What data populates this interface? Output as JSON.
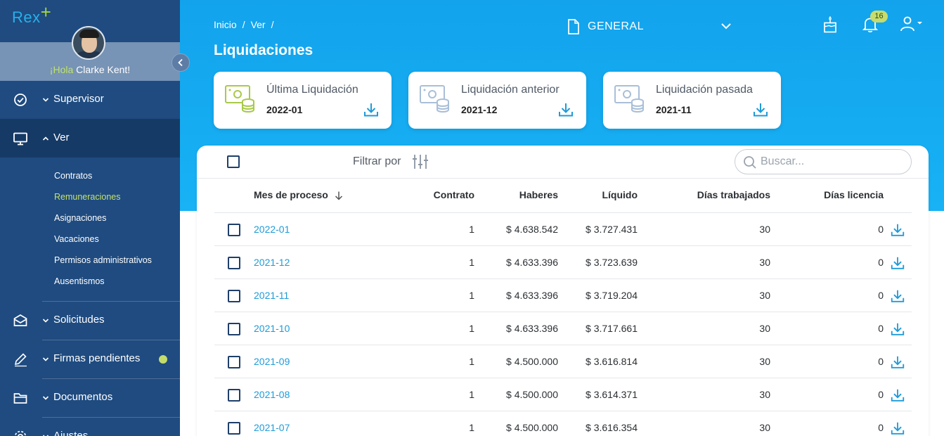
{
  "app": {
    "logo_text": "Rex",
    "logo_plus": "+"
  },
  "user": {
    "greeting": "¡Hola",
    "name": "Clarke Kent!"
  },
  "colors": {
    "sidebar": "#1f4b80",
    "header": "#12a3ec",
    "accent_green": "#c4dc6a",
    "link": "#1e9bd8"
  },
  "sidebar": {
    "collapse_icon": "chevron-left-icon",
    "items": [
      {
        "label": "Supervisor",
        "icon": "check-circle-icon",
        "expanded": false
      },
      {
        "label": "Ver",
        "icon": "monitor-icon",
        "expanded": true
      },
      {
        "label": "Solicitudes",
        "icon": "envelope-icon",
        "expanded": false
      },
      {
        "label": "Firmas pendientes",
        "icon": "pen-icon",
        "expanded": false
      },
      {
        "label": "Documentos",
        "icon": "folder-icon",
        "expanded": false
      },
      {
        "label": "Ajustes",
        "icon": "gear-icon",
        "expanded": false
      }
    ],
    "subitems": [
      "Contratos",
      "Remuneraciones",
      "Asignaciones",
      "Vacaciones",
      "Permisos administrativos",
      "Ausentismos"
    ],
    "current_subitem": "Remuneraciones"
  },
  "header": {
    "breadcrumb": [
      "Inicio",
      "/",
      "Ver",
      "/"
    ],
    "title": "Liquidaciones",
    "company": "GENERAL",
    "notifications_count": "16"
  },
  "cards": [
    {
      "title": "Última Liquidación",
      "period": "2022-01",
      "icon_color": "#a9c94a"
    },
    {
      "title": "Liquidación anterior",
      "period": "2021-12",
      "icon_color": "#a9bfd8"
    },
    {
      "title": "Liquidación pasada",
      "period": "2021-11",
      "icon_color": "#a9bfd8"
    }
  ],
  "toolbar": {
    "filter_label": "Filtrar por",
    "search_placeholder": "Buscar..."
  },
  "table": {
    "columns": [
      "Mes de proceso",
      "Contrato",
      "Haberes",
      "Líquido",
      "Días trabajados",
      "Días licencia"
    ],
    "rows": [
      [
        "2022-01",
        "1",
        "$ 4.638.542",
        "$ 3.727.431",
        "30",
        "0"
      ],
      [
        "2021-12",
        "1",
        "$ 4.633.396",
        "$ 3.723.639",
        "30",
        "0"
      ],
      [
        "2021-11",
        "1",
        "$ 4.633.396",
        "$ 3.719.204",
        "30",
        "0"
      ],
      [
        "2021-10",
        "1",
        "$ 4.633.396",
        "$ 3.717.661",
        "30",
        "0"
      ],
      [
        "2021-09",
        "1",
        "$ 4.500.000",
        "$ 3.616.814",
        "30",
        "0"
      ],
      [
        "2021-08",
        "1",
        "$ 4.500.000",
        "$ 3.614.371",
        "30",
        "0"
      ],
      [
        "2021-07",
        "1",
        "$ 4.500.000",
        "$ 3.616.354",
        "30",
        "0"
      ]
    ]
  }
}
